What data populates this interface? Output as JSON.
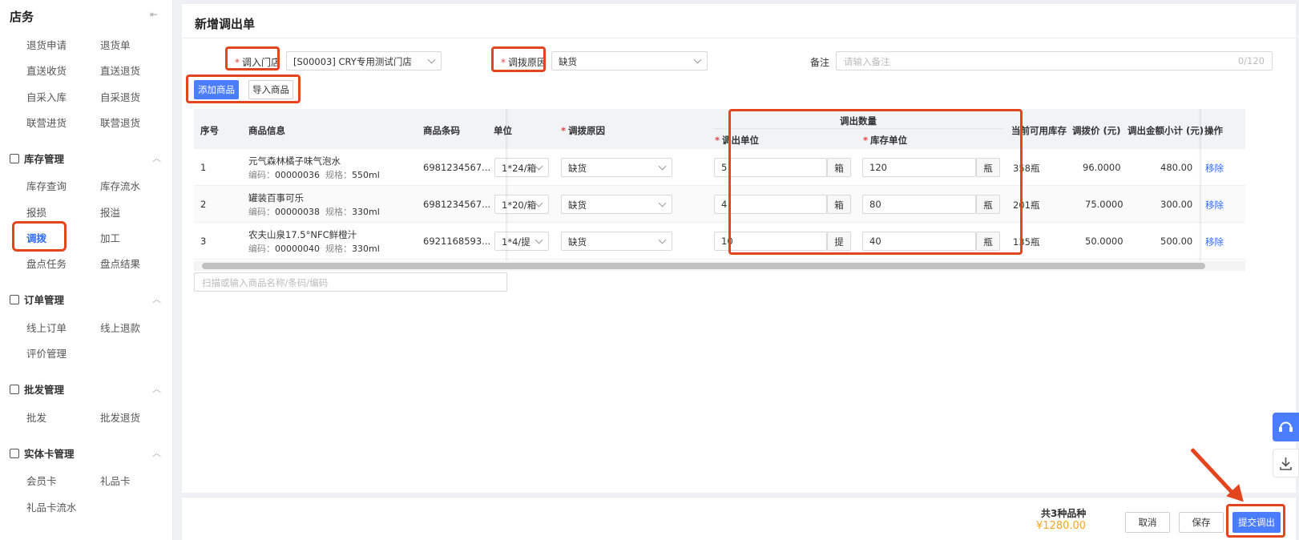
{
  "sidebar": {
    "header": "店务",
    "collapse_icon": "⇤",
    "top_items": [
      "退货申请",
      "退货单",
      "直送收货",
      "直送退货",
      "自采入库",
      "自采退货",
      "联营进货",
      "联营退货"
    ],
    "sections": [
      {
        "title": "库存管理",
        "items": [
          "库存查询",
          "库存流水",
          "报损",
          "报溢",
          "调拨",
          "加工",
          "盘点任务",
          "盘点结果"
        ]
      },
      {
        "title": "订单管理",
        "items": [
          "线上订单",
          "线上退款",
          "评价管理"
        ]
      },
      {
        "title": "批发管理",
        "items": [
          "批发",
          "批发退货"
        ]
      },
      {
        "title": "实体卡管理",
        "items": [
          "会员卡",
          "礼品卡",
          "礼品卡流水"
        ]
      }
    ],
    "active_item": "调拨"
  },
  "page": {
    "title": "新增调出单"
  },
  "form": {
    "in_store_label": "调入门店",
    "in_store_value": "[S00003] CRY专用测试门店",
    "reason_label": "调拨原因",
    "reason_value": "缺货",
    "note_label": "备注",
    "note_placeholder": "请输入备注",
    "note_count": "0/120"
  },
  "buttons": {
    "add_goods": "添加商品",
    "import_goods": "导入商品",
    "cancel": "取消",
    "save": "保存",
    "submit": "提交调出"
  },
  "table": {
    "headers": {
      "index": "序号",
      "goods": "商品信息",
      "barcode": "商品条码",
      "unit": "单位",
      "reason": "调拨原因",
      "qty_group": "调出数量",
      "out_unit": "调出单位",
      "stock_unit": "库存单位",
      "available": "当前可用库存",
      "price": "调拨价 (元)",
      "subtotal": "调出金额小计 (元)",
      "action": "操作"
    },
    "code_label": "编码：",
    "spec_label": "规格：",
    "rows": [
      {
        "index": "1",
        "name": "元气森林橘子味气泡水",
        "code": "00000036",
        "spec": "550ml",
        "barcode": "6981234567...",
        "unit": "1*24/箱",
        "reason": "缺货",
        "out_qty": "5",
        "out_unit": "箱",
        "stock_qty": "120",
        "stock_unit": "瓶",
        "available": "358瓶",
        "price": "96.0000",
        "subtotal": "480.00",
        "action": "移除"
      },
      {
        "index": "2",
        "name": "罐装百事可乐",
        "code": "00000038",
        "spec": "330ml",
        "barcode": "6981234567...",
        "unit": "1*20/箱",
        "reason": "缺货",
        "out_qty": "4",
        "out_unit": "箱",
        "stock_qty": "80",
        "stock_unit": "瓶",
        "available": "201瓶",
        "price": "75.0000",
        "subtotal": "300.00",
        "action": "移除"
      },
      {
        "index": "3",
        "name": "农夫山泉17.5°NFC鲜橙汁",
        "code": "00000040",
        "spec": "330ml",
        "barcode": "6921168593...",
        "unit": "1*4/提",
        "reason": "缺货",
        "out_qty": "10",
        "out_unit": "提",
        "stock_qty": "40",
        "stock_unit": "瓶",
        "available": "135瓶",
        "price": "50.0000",
        "subtotal": "500.00",
        "action": "移除"
      }
    ],
    "scan_placeholder": "扫描或输入商品名称/条码/编码"
  },
  "footer": {
    "total_label": "共3种品种",
    "total_amount": "¥1280.00"
  },
  "colors": {
    "primary": "#4a7dff",
    "highlight": "#e3461e",
    "amount": "#f5a623",
    "link": "#2f6bff"
  }
}
